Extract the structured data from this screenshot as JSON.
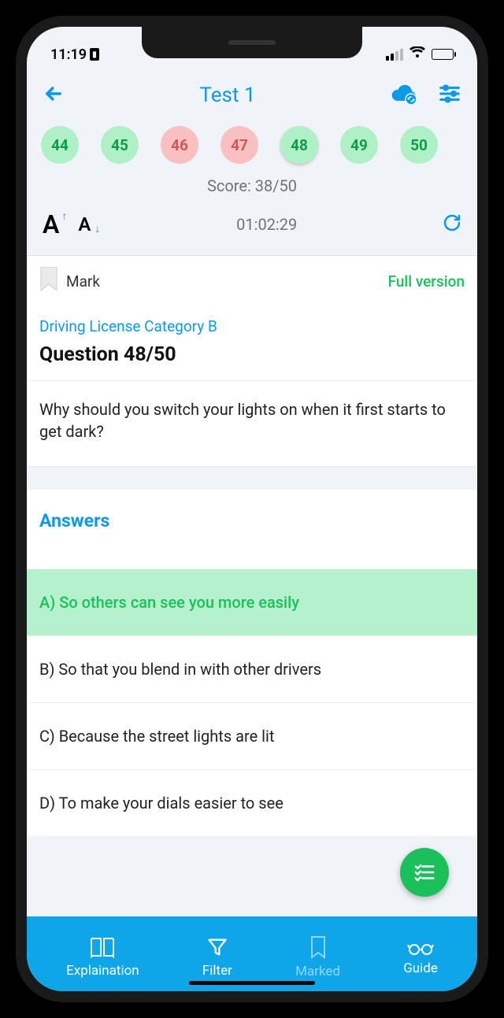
{
  "status": {
    "time": "11:19"
  },
  "header": {
    "title": "Test 1"
  },
  "pager": {
    "items": [
      {
        "num": "44",
        "cls": "pager-green"
      },
      {
        "num": "45",
        "cls": "pager-green"
      },
      {
        "num": "46",
        "cls": "pager-red"
      },
      {
        "num": "47",
        "cls": "pager-red"
      },
      {
        "num": "48",
        "cls": "pager-green pager-current"
      },
      {
        "num": "49",
        "cls": "pager-green"
      },
      {
        "num": "50",
        "cls": "pager-green"
      }
    ]
  },
  "score_line": "Score: 38/50",
  "timer": "01:02:29",
  "mark_label": "Mark",
  "full_version": "Full version",
  "category": "Driving License Category B",
  "question_num": "Question 48/50",
  "question_text": "Why should you switch your lights on when it first starts to get dark?",
  "answers_header": "Answers",
  "answers": [
    {
      "text": "A) So others can see you more easily",
      "correct": true
    },
    {
      "text": "B) So that you blend in with other drivers",
      "correct": false
    },
    {
      "text": "C) Because the street lights are lit",
      "correct": false
    },
    {
      "text": "D) To make your dials easier to see",
      "correct": false
    }
  ],
  "nav": {
    "explain": "Explaination",
    "filter": "Filter",
    "marked": "Marked",
    "guide": "Guide"
  }
}
